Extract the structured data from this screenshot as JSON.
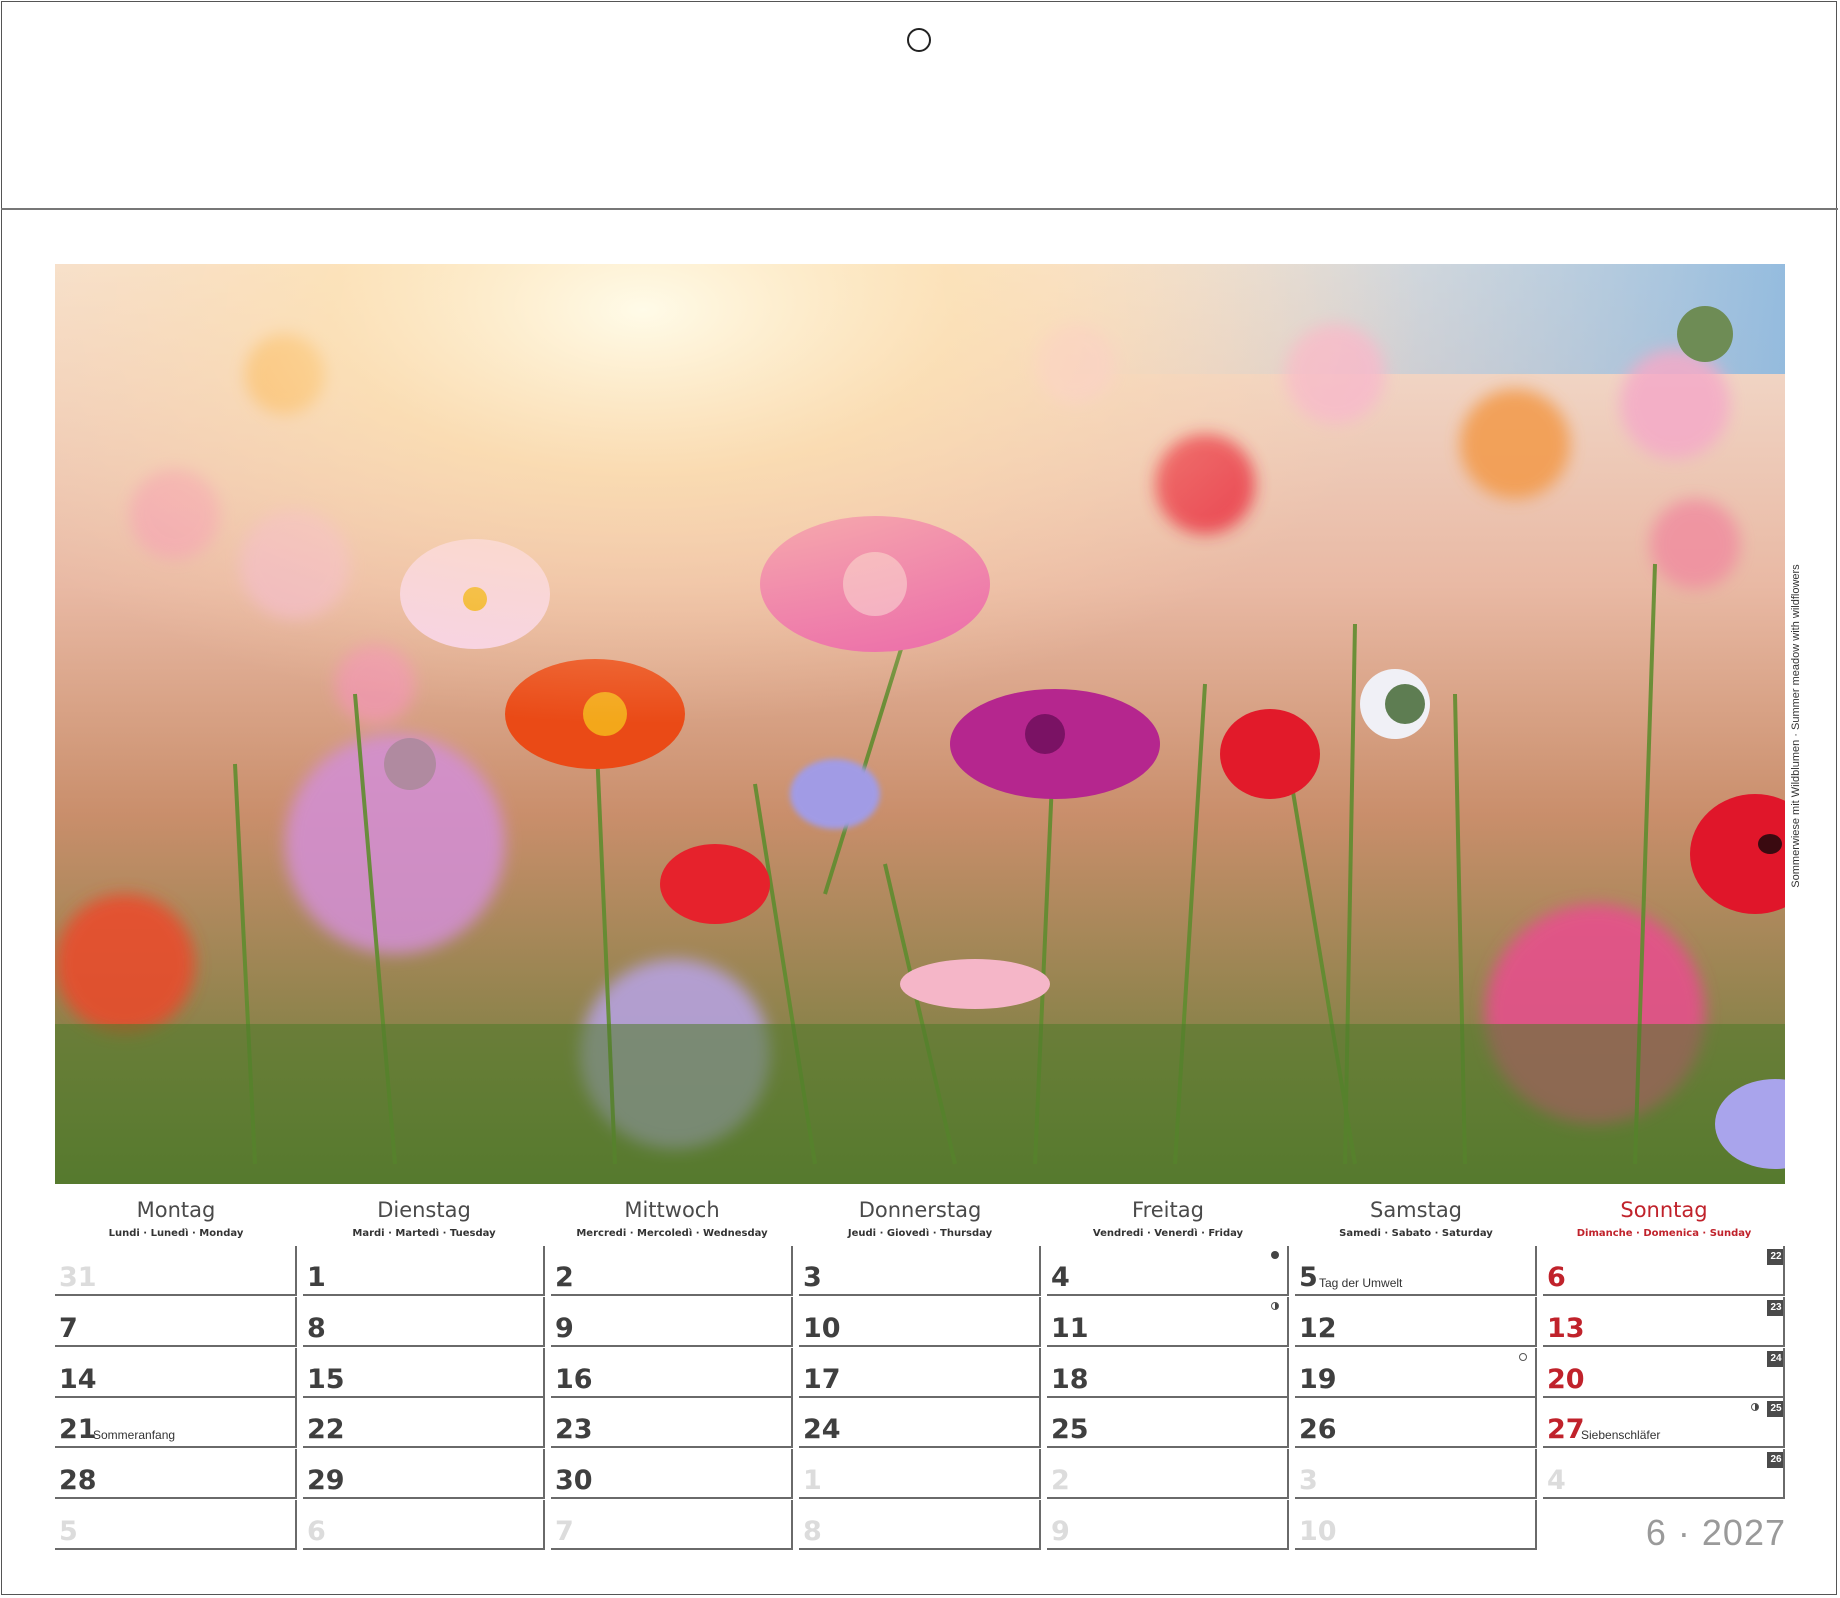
{
  "caption": "Sommerwiese mit Wildblumen · Summer meadow with wildflowers",
  "weekdays": [
    {
      "name": "Montag",
      "sub": "Lundi · Lunedì · Monday"
    },
    {
      "name": "Dienstag",
      "sub": "Mardi · Martedì · Tuesday"
    },
    {
      "name": "Mittwoch",
      "sub": "Mercredi · Mercoledì · Wednesday"
    },
    {
      "name": "Donnerstag",
      "sub": "Jeudi · Giovedì · Thursday"
    },
    {
      "name": "Freitag",
      "sub": "Vendredi · Venerdì · Friday"
    },
    {
      "name": "Samstag",
      "sub": "Samedi · Sabato · Saturday"
    },
    {
      "name": "Sonntag",
      "sub": "Dimanche · Domenica · Sunday"
    }
  ],
  "weeks": [
    {
      "kw": "22",
      "days": [
        {
          "n": "31",
          "other": true
        },
        {
          "n": "1"
        },
        {
          "n": "2"
        },
        {
          "n": "3"
        },
        {
          "n": "4",
          "moon": "new"
        },
        {
          "n": "5",
          "note": "Tag der Umwelt"
        },
        {
          "n": "6"
        }
      ]
    },
    {
      "kw": "23",
      "days": [
        {
          "n": "7"
        },
        {
          "n": "8"
        },
        {
          "n": "9"
        },
        {
          "n": "10"
        },
        {
          "n": "11",
          "moon": "half"
        },
        {
          "n": "12"
        },
        {
          "n": "13"
        }
      ]
    },
    {
      "kw": "24",
      "days": [
        {
          "n": "14"
        },
        {
          "n": "15"
        },
        {
          "n": "16"
        },
        {
          "n": "17"
        },
        {
          "n": "18"
        },
        {
          "n": "19",
          "moon": "full"
        },
        {
          "n": "20"
        }
      ]
    },
    {
      "kw": "25",
      "days": [
        {
          "n": "21",
          "note": "Sommeranfang"
        },
        {
          "n": "22"
        },
        {
          "n": "23"
        },
        {
          "n": "24"
        },
        {
          "n": "25"
        },
        {
          "n": "26"
        },
        {
          "n": "27",
          "note": "Siebenschläfer",
          "moon": "half"
        }
      ]
    },
    {
      "kw": "26",
      "days": [
        {
          "n": "28"
        },
        {
          "n": "29"
        },
        {
          "n": "30"
        },
        {
          "n": "1",
          "other": true
        },
        {
          "n": "2",
          "other": true
        },
        {
          "n": "3",
          "other": true
        },
        {
          "n": "4",
          "other": true
        }
      ]
    },
    {
      "kw": "",
      "days": [
        {
          "n": "5",
          "other": true
        },
        {
          "n": "6",
          "other": true
        },
        {
          "n": "7",
          "other": true
        },
        {
          "n": "8",
          "other": true
        },
        {
          "n": "9",
          "other": true
        },
        {
          "n": "10",
          "other": true
        },
        null
      ]
    }
  ],
  "month_label": "6 · 2027",
  "colors": {
    "sunday": "#c0222b",
    "border": "#6a6a6a",
    "other_month": "#dcdcdc"
  }
}
